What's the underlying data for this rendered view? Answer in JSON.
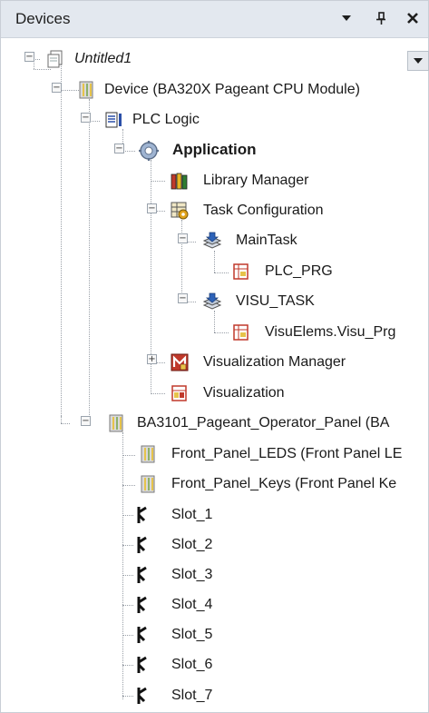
{
  "panel": {
    "title": "Devices",
    "buttons": {
      "menu_icon": "triangle-down",
      "pin_icon": "pin",
      "close_icon": "close"
    }
  },
  "tree": {
    "root": {
      "label": "Untitled1",
      "icon": "project-file"
    },
    "device": {
      "label": "Device (BA320X Pageant CPU Module)",
      "icon": "device"
    },
    "plc_logic": {
      "label": "PLC Logic",
      "icon": "plc-logic"
    },
    "application": {
      "label": "Application",
      "icon": "gear"
    },
    "library_manager": {
      "label": "Library Manager",
      "icon": "books"
    },
    "task_configuration": {
      "label": "Task Configuration",
      "icon": "task-config"
    },
    "main_task": {
      "label": "MainTask",
      "icon": "task"
    },
    "plc_prg": {
      "label": "PLC_PRG",
      "icon": "program"
    },
    "visu_task": {
      "label": "VISU_TASK",
      "icon": "task"
    },
    "visu_prg": {
      "label": "VisuElems.Visu_Prg",
      "icon": "program"
    },
    "visualization_manager": {
      "label": "Visualization Manager",
      "icon": "visu-manager"
    },
    "visualization": {
      "label": "Visualization",
      "icon": "visualization"
    },
    "operator_panel": {
      "label": "BA3101_Pageant_Operator_Panel (BA",
      "icon": "device"
    },
    "front_panel_leds": {
      "label": "Front_Panel_LEDS (Front Panel LE",
      "icon": "device"
    },
    "front_panel_keys": {
      "label": "Front_Panel_Keys (Front Panel Ke",
      "icon": "device"
    },
    "slots": [
      "Slot_1",
      "Slot_2",
      "Slot_3",
      "Slot_4",
      "Slot_5",
      "Slot_6",
      "Slot_7"
    ]
  }
}
